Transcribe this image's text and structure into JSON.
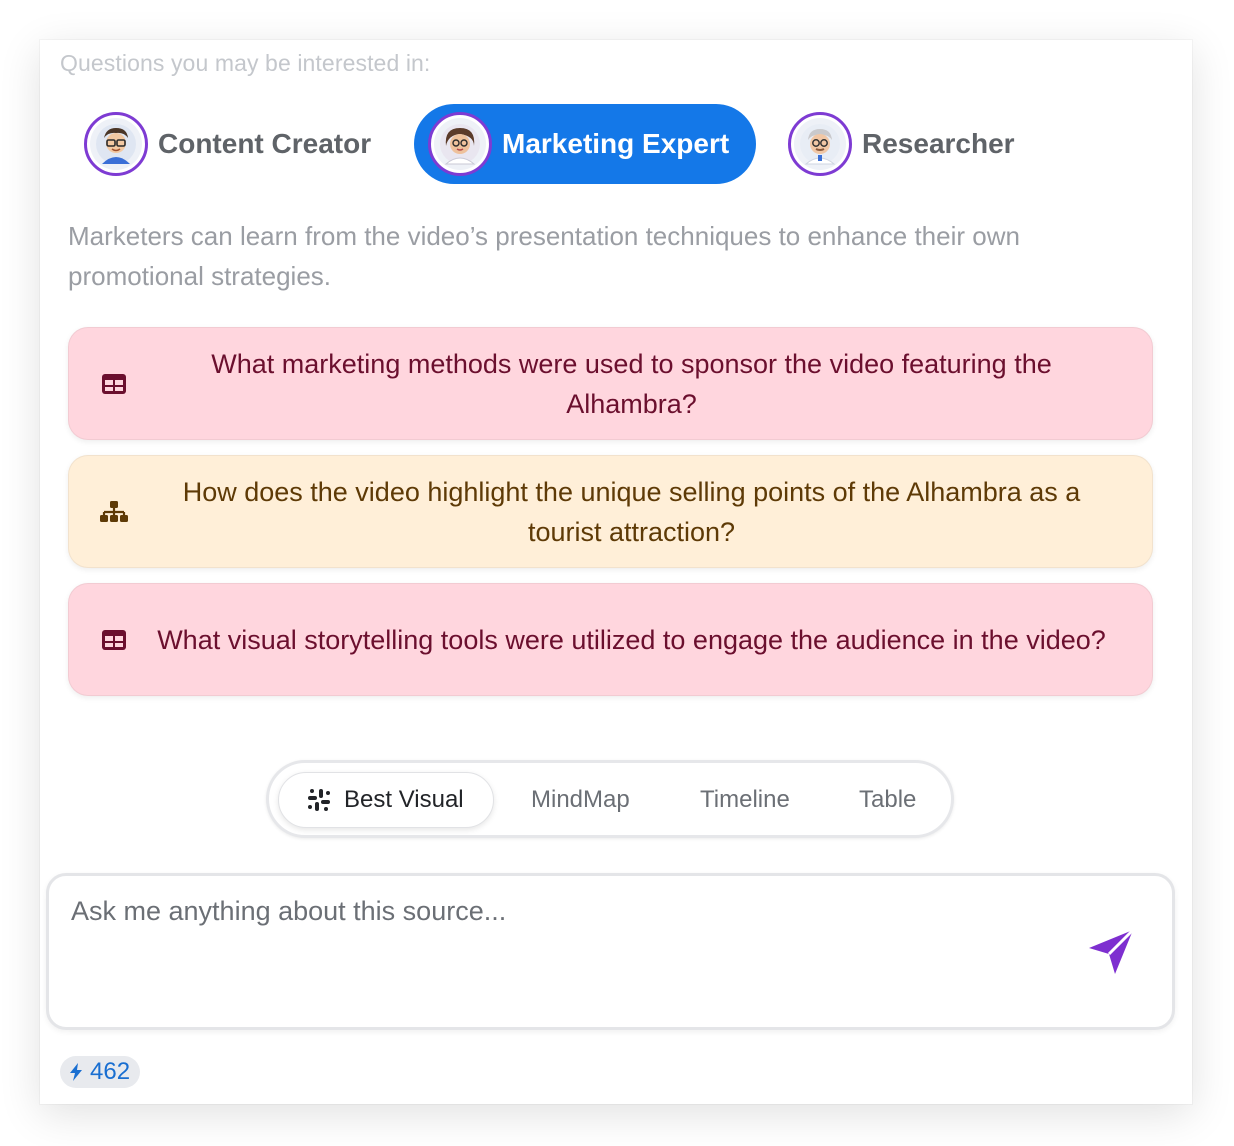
{
  "header": {
    "text": "Questions you may be interested in:"
  },
  "personas": [
    {
      "label": "Content Creator",
      "avatar": "content-creator-avatar",
      "active": false
    },
    {
      "label": "Marketing Expert",
      "avatar": "marketing-expert-avatar",
      "active": true
    },
    {
      "label": "Researcher",
      "avatar": "researcher-avatar",
      "active": false
    }
  ],
  "description": "Marketers can learn from the video’s presentation techniques to enhance their own promotional strategies.",
  "questions": [
    {
      "text": "What marketing methods were used to sponsor the video featuring the Alhambra?",
      "icon": "table-icon",
      "color": "#ffd6de"
    },
    {
      "text": "How does the video highlight the unique selling points of the Alhambra as a tourist attraction?",
      "icon": "hierarchy-icon",
      "color": "#ffefd8"
    },
    {
      "text": "What visual storytelling tools were utilized to engage the audience in the video?",
      "icon": "table-icon",
      "color": "#ffd6de"
    }
  ],
  "view_tabs": {
    "best_visual": "Best Visual",
    "mindmap": "MindMap",
    "timeline": "Timeline",
    "table": "Table",
    "active": "Best Visual"
  },
  "input": {
    "placeholder": "Ask me anything about this source...",
    "value": ""
  },
  "credits": {
    "value": "462"
  },
  "colors": {
    "accent_blue": "#1478e8",
    "avatar_ring": "#7e3bd3",
    "send_icon": "#7e2fd0",
    "credits_text": "#1a6fd1"
  }
}
